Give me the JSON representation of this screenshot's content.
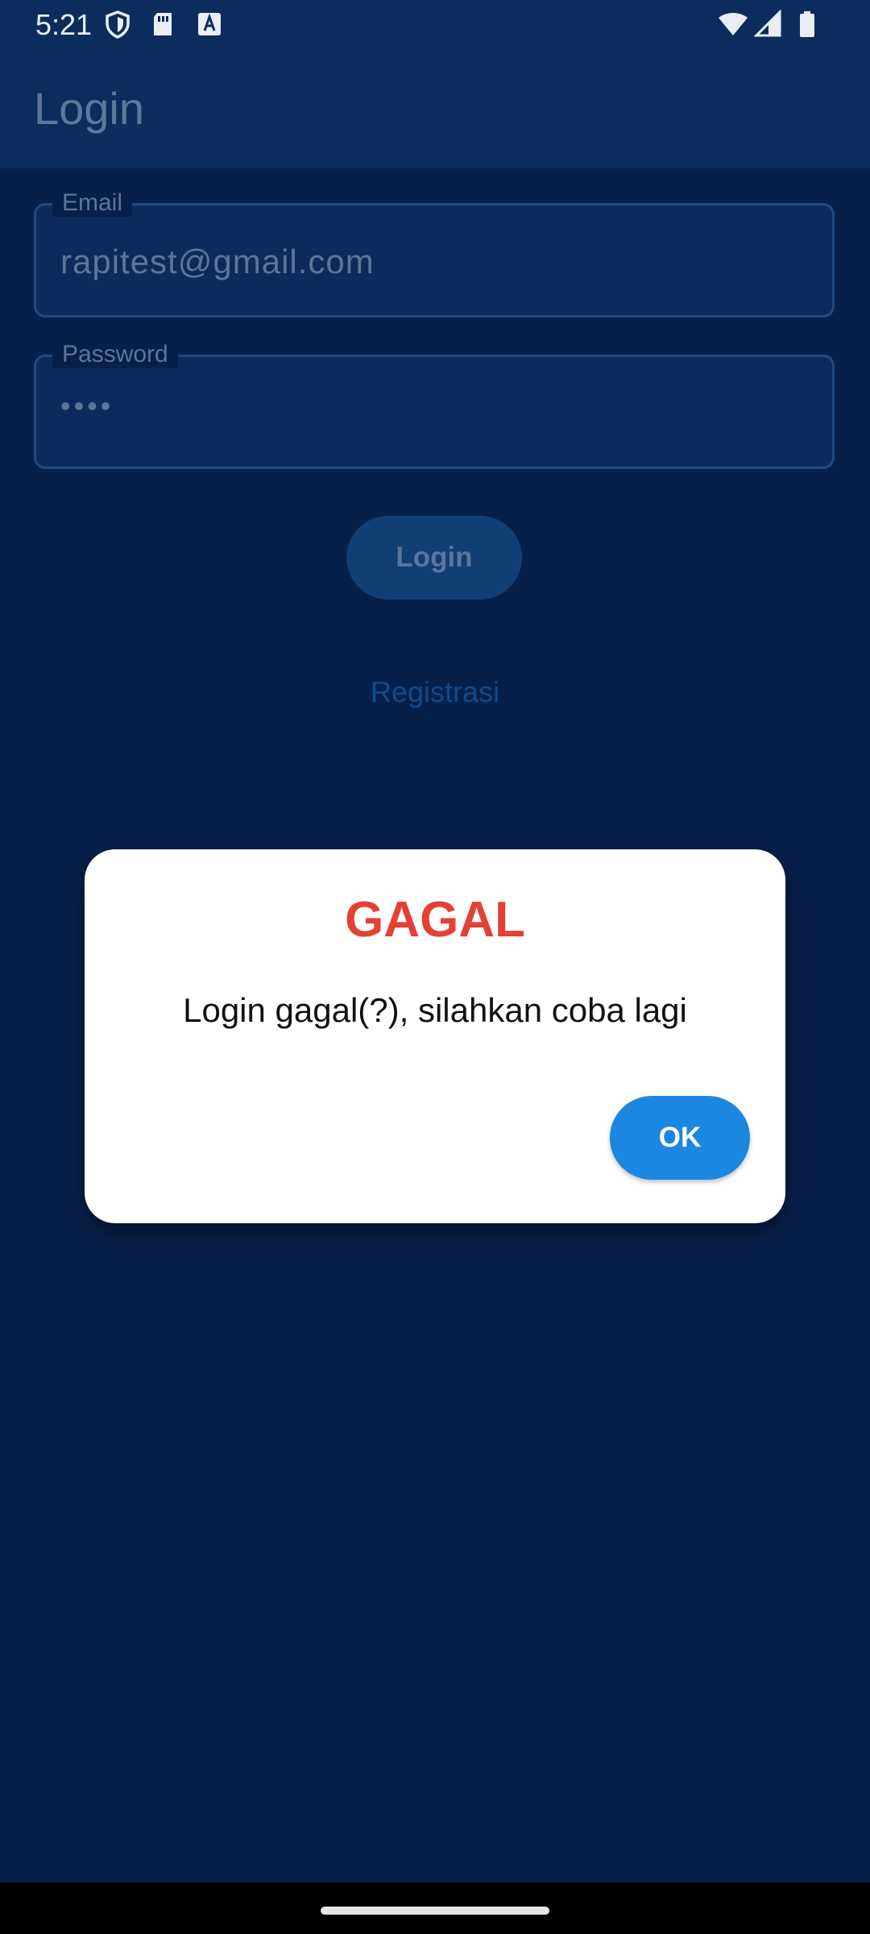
{
  "status_bar": {
    "time": "5:21",
    "left_icons": [
      "shield-icon",
      "sd-card-icon",
      "keyboard-a-icon"
    ],
    "right_icons": [
      "wifi-icon",
      "signal-icon",
      "battery-icon"
    ]
  },
  "app_bar": {
    "title": "Login"
  },
  "form": {
    "email": {
      "label": "Email",
      "value": "rapitest@gmail.com"
    },
    "password": {
      "label": "Password",
      "value": "••••"
    },
    "login_button": "Login",
    "register_link": "Registrasi"
  },
  "dialog": {
    "title": "GAGAL",
    "message": "Login gagal(?), silahkan coba lagi",
    "ok_button": "OK"
  },
  "colors": {
    "background": "#07204a",
    "app_bar": "#0c2d5c",
    "dialog_title": "#e24133",
    "ok_button": "#1c87e0"
  }
}
